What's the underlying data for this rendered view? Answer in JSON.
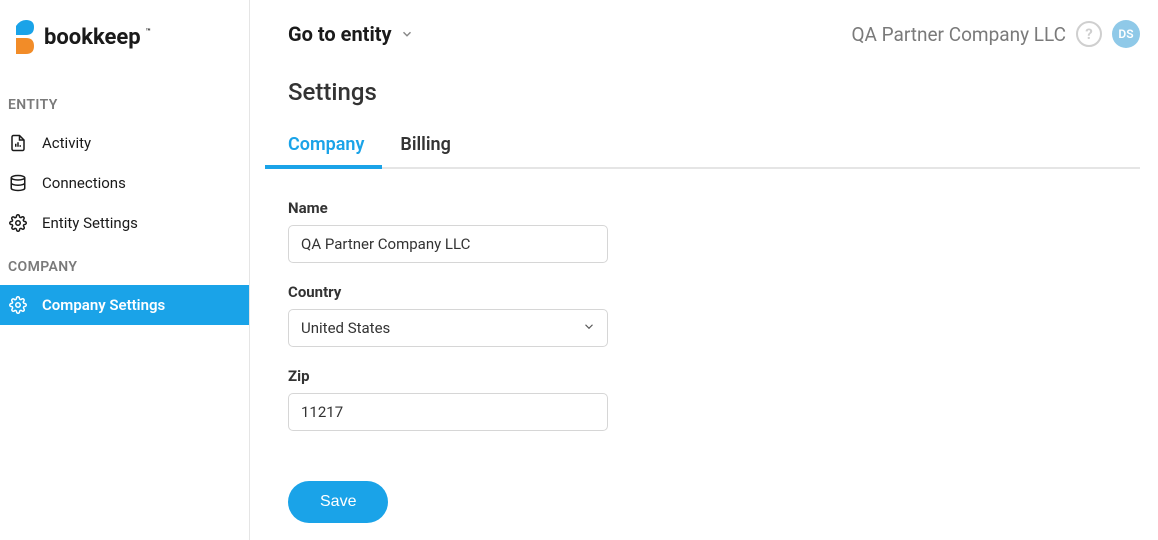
{
  "logo": {
    "text": "bookkeep"
  },
  "sidebar": {
    "sections": [
      {
        "label": "ENTITY",
        "items": [
          {
            "label": "Activity"
          },
          {
            "label": "Connections"
          },
          {
            "label": "Entity Settings"
          }
        ]
      },
      {
        "label": "COMPANY",
        "items": [
          {
            "label": "Company Settings"
          }
        ]
      }
    ]
  },
  "header": {
    "entity_selector_label": "Go to entity",
    "company_name": "QA Partner Company LLC",
    "help": "?",
    "avatar_initials": "DS"
  },
  "page": {
    "title": "Settings"
  },
  "tabs": {
    "company": "Company",
    "billing": "Billing"
  },
  "form": {
    "name_label": "Name",
    "name_value": "QA Partner Company LLC",
    "country_label": "Country",
    "country_value": "United States",
    "zip_label": "Zip",
    "zip_value": "11217",
    "save_label": "Save"
  }
}
